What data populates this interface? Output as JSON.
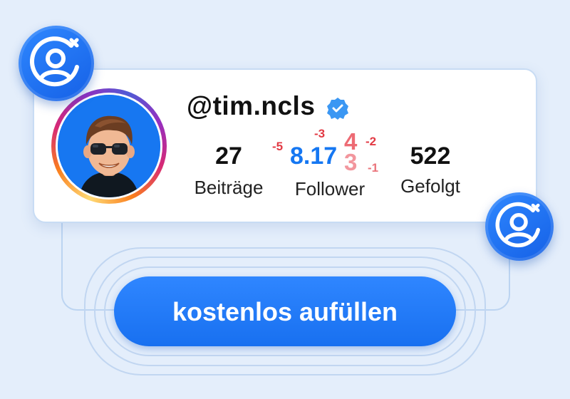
{
  "profile": {
    "handle": "@tim.ncls",
    "verified": true
  },
  "stats": {
    "posts_value": "27",
    "posts_label": "Beiträge",
    "followers_value": "8.17",
    "followers_rolling_digit_top": "4",
    "followers_rolling_digit_bottom": "3",
    "followers_label": "Follower",
    "following_value": "522",
    "following_label": "Gefolgt"
  },
  "follower_deltas": [
    "-5",
    "-3",
    "-2",
    "-1"
  ],
  "cta": {
    "label": "kostenlos aufüllen"
  },
  "icons": {
    "add_user_badge": "user-add-icon",
    "verified": "verified-badge-icon"
  },
  "colors": {
    "brand_blue": "#1577f2",
    "delta_red": "#e23a44",
    "background": "#e4eefb"
  }
}
